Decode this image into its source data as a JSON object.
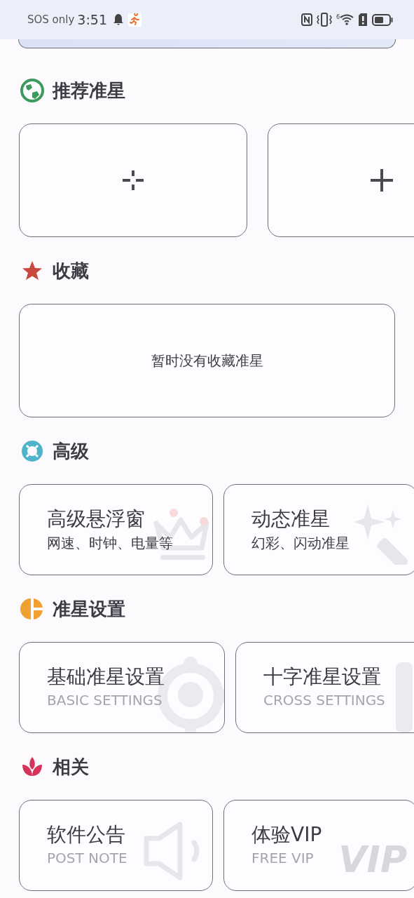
{
  "status_bar": {
    "carrier": "SOS only",
    "time": "3:51",
    "wifi_badge": "6"
  },
  "sections": [
    {
      "title": "推荐准星",
      "kind": "presets",
      "items": [
        {
          "kind": "gap-cross"
        },
        {
          "kind": "plus"
        }
      ]
    },
    {
      "title": "收藏",
      "kind": "empty",
      "message": "暂时没有收藏准星"
    },
    {
      "title": "高级",
      "kind": "feature-tiles",
      "items": [
        {
          "title": "高级悬浮窗",
          "subtitle": "网速、时钟、电量等"
        },
        {
          "title": "动态准星",
          "subtitle": "幻彩、闪动准星"
        }
      ]
    },
    {
      "title": "准星设置",
      "kind": "link-tiles",
      "items": [
        {
          "title": "基础准星设置",
          "subtitle": "BASIC SETTINGS"
        },
        {
          "title": "十字准星设置",
          "subtitle": "CROSS SETTINGS"
        }
      ]
    },
    {
      "title": "相关",
      "kind": "link-tiles",
      "items": [
        {
          "title": "软件公告",
          "subtitle": "POST NOTE"
        },
        {
          "title": "体验VIP",
          "subtitle": "FREE VIP",
          "art_text": "VIP"
        }
      ]
    }
  ]
}
